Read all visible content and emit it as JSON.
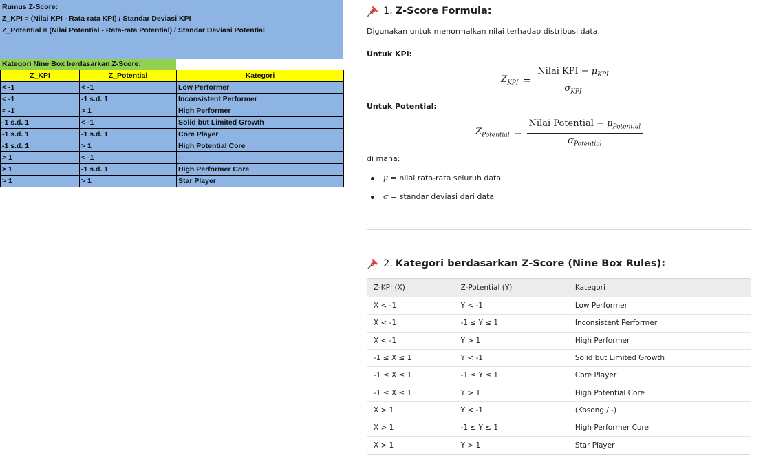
{
  "spreadsheet": {
    "formula_title": "Rumus Z-Score:",
    "formula_kpi": "Z_KPI = (Nilai KPI - Rata-rata KPI) / Standar Deviasi KPI",
    "formula_potential": "Z_Potential = (Nilai Potential - Rata-rata Potential) / Standar Deviasi Potential",
    "category_title": "Kategori Nine Box berdasarkan Z-Score:",
    "headers": [
      "Z_KPI",
      "Z_Potential",
      "Kategori"
    ],
    "rows": [
      [
        "< -1",
        "< -1",
        "Low Performer"
      ],
      [
        "< -1",
        "-1 s.d. 1",
        "Inconsistent Performer"
      ],
      [
        "< -1",
        "> 1",
        "High Performer"
      ],
      [
        "-1 s.d. 1",
        "< -1",
        "Solid but Limited Growth"
      ],
      [
        "-1 s.d. 1",
        "-1 s.d. 1",
        "Core Player"
      ],
      [
        "-1 s.d. 1",
        "> 1",
        "High Potential Core"
      ],
      [
        "> 1",
        "< -1",
        "-"
      ],
      [
        "> 1",
        "-1 s.d. 1",
        "High Performer Core"
      ],
      [
        "> 1",
        "> 1",
        "Star Player"
      ]
    ]
  },
  "doc": {
    "pin_icon": "pushpin-icon",
    "section1": {
      "number": "1.",
      "title": "Z-Score Formula:",
      "intro": "Digunakan untuk menormalkan nilai terhadap distribusi data.",
      "kpi_label": "Untuk KPI:",
      "kpi_eq": {
        "lhs": "Z",
        "lhs_sub": "KPI",
        "numer_text": "Nilai KPI − ",
        "numer_mu": "μ",
        "numer_sub": "KPI",
        "denom": "σ",
        "denom_sub": "KPI"
      },
      "potential_label": "Untuk Potential:",
      "potential_eq": {
        "lhs": "Z",
        "lhs_sub": "Potential",
        "numer_text": "Nilai Potential − ",
        "numer_mu": "μ",
        "numer_sub": "Potential",
        "denom": "σ",
        "denom_sub": "Potential"
      },
      "where": "di mana:",
      "bullets": [
        {
          "symbol": "μ",
          "text": " = nilai rata-rata seluruh data"
        },
        {
          "symbol": "σ",
          "text": " = standar deviasi dari data"
        }
      ]
    },
    "section2": {
      "number": "2.",
      "title": "Kategori berdasarkan Z-Score (Nine Box Rules):",
      "headers": [
        "Z-KPI (X)",
        "Z-Potential (Y)",
        "Kategori"
      ],
      "rows": [
        [
          "X < -1",
          "Y < -1",
          "Low Performer"
        ],
        [
          "X < -1",
          "-1 ≤ Y ≤ 1",
          "Inconsistent Performer"
        ],
        [
          "X < -1",
          "Y > 1",
          "High Performer"
        ],
        [
          "-1 ≤ X ≤ 1",
          "Y < -1",
          "Solid but Limited Growth"
        ],
        [
          "-1 ≤ X ≤ 1",
          "-1 ≤ Y ≤ 1",
          "Core Player"
        ],
        [
          "-1 ≤ X ≤ 1",
          "Y > 1",
          "High Potential Core"
        ],
        [
          "X > 1",
          "Y < -1",
          "(Kosong / -)"
        ],
        [
          "X > 1",
          "-1 ≤ Y ≤ 1",
          "High Performer Core"
        ],
        [
          "X > 1",
          "Y > 1",
          "Star Player"
        ]
      ]
    }
  },
  "colors": {
    "formula_bg": "#8eb4e3",
    "category_title_bg": "#92d050",
    "header_bg": "#ffff00"
  }
}
